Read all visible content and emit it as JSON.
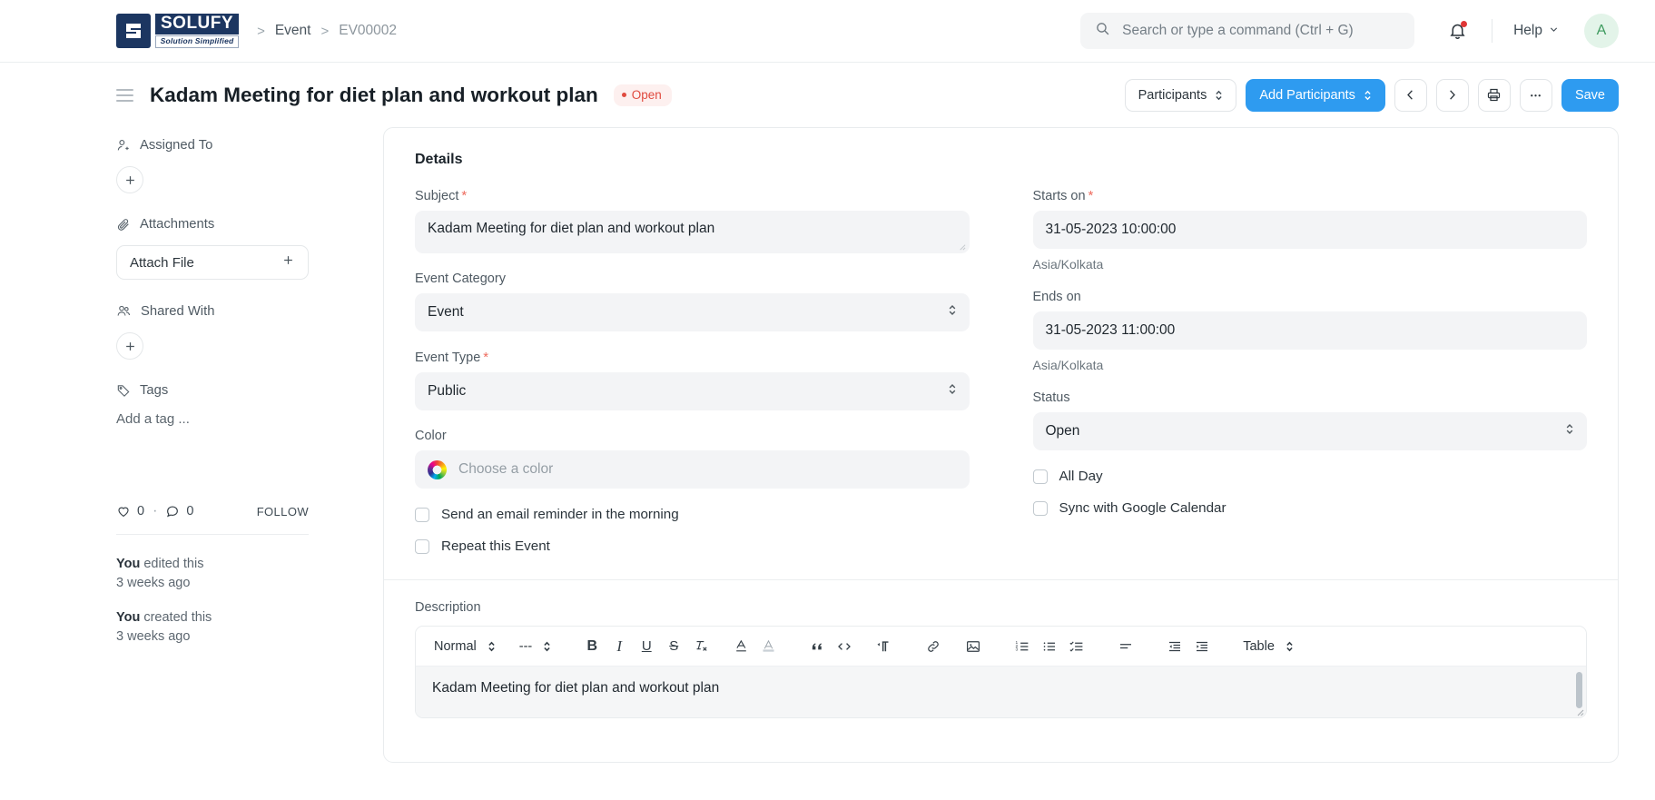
{
  "navbar": {
    "logo": {
      "name": "SOLUFY",
      "tagline": "Solution Simplified"
    },
    "breadcrumbs": [
      {
        "label": "Event",
        "muted": false
      },
      {
        "label": "EV00002",
        "muted": true
      }
    ],
    "separator": ">",
    "search": {
      "placeholder": "Search or type a command (Ctrl + G)",
      "value": "",
      "icon": "search-icon"
    },
    "notifications": {
      "icon": "bell-icon",
      "has_unread": true,
      "dot_color": "#e03636"
    },
    "help": {
      "label": "Help",
      "icon": "chevron-down-icon"
    },
    "avatar": {
      "initial": "A",
      "bg": "#e3f4e9",
      "fg": "#3f9b5f"
    }
  },
  "pagehead": {
    "menu_icon": "hamburger-icon",
    "title": "Kadam Meeting for diet plan and workout plan",
    "status": {
      "label": "Open",
      "color": "#e04a3f",
      "bg": "#fdf0ef"
    },
    "actions": {
      "participants": "Participants",
      "add_participants": "Add Participants",
      "prev_icon": "chevron-left-icon",
      "next_icon": "chevron-right-icon",
      "print_icon": "printer-icon",
      "more_icon": "ellipsis-icon",
      "save": "Save"
    },
    "accent": "#2e9bf0"
  },
  "sidebar": {
    "sections": [
      {
        "label": "Assigned To",
        "icon": "user-plus-icon",
        "control": "add-button"
      },
      {
        "label": "Attachments",
        "icon": "paperclip-icon",
        "control": "attach-file",
        "button_label": "Attach File",
        "button_icon": "plus-icon"
      },
      {
        "label": "Shared With",
        "icon": "users-icon",
        "control": "add-button"
      },
      {
        "label": "Tags",
        "icon": "tag-icon",
        "control": "tag-input",
        "placeholder": "Add a tag ..."
      }
    ],
    "social": {
      "like_icon": "heart-icon",
      "like_count": "0",
      "separator": "·",
      "comment_icon": "comment-icon",
      "comment_count": "0",
      "follow_label": "FOLLOW"
    },
    "activity": [
      {
        "actor": "You",
        "action": "edited this",
        "time": "3 weeks ago"
      },
      {
        "actor": "You",
        "action": "created this",
        "time": "3 weeks ago"
      }
    ]
  },
  "details": {
    "heading": "Details",
    "left": {
      "subject": {
        "label": "Subject",
        "required": true,
        "value": "Kadam Meeting for diet plan and workout plan"
      },
      "event_category": {
        "label": "Event Category",
        "required": false,
        "value": "Event"
      },
      "event_type": {
        "label": "Event Type",
        "required": true,
        "value": "Public"
      },
      "color": {
        "label": "Color",
        "required": false,
        "value": "",
        "placeholder": "Choose a color",
        "icon": "color-wheel-icon"
      },
      "email_reminder": {
        "label": "Send an email reminder in the morning",
        "checked": false
      },
      "repeat_event": {
        "label": "Repeat this Event",
        "checked": false
      }
    },
    "right": {
      "starts_on": {
        "label": "Starts on",
        "required": true,
        "value": "31-05-2023 10:00:00",
        "timezone": "Asia/Kolkata"
      },
      "ends_on": {
        "label": "Ends on",
        "required": false,
        "value": "31-05-2023 11:00:00",
        "timezone": "Asia/Kolkata"
      },
      "status": {
        "label": "Status",
        "required": false,
        "value": "Open"
      },
      "all_day": {
        "label": "All Day",
        "checked": false
      },
      "sync_google": {
        "label": "Sync with Google Calendar",
        "checked": false
      }
    }
  },
  "description": {
    "label": "Description",
    "toolbar": {
      "style_select": "Normal",
      "font_select": "---",
      "bold": "B",
      "italic": "I",
      "underline": "U",
      "strike": "S",
      "clear_format_icon": "clear-formatting-icon",
      "font_color_icon": "font-color-icon",
      "highlight_icon": "highlight-icon",
      "quote_icon": "blockquote-icon",
      "code_icon": "code-icon",
      "direction_icon": "text-direction-icon",
      "link_icon": "link-icon",
      "image_icon": "image-icon",
      "ordered_list_icon": "ordered-list-icon",
      "bullet_list_icon": "bullet-list-icon",
      "check_list_icon": "check-list-icon",
      "align_icon": "align-icon",
      "outdent_icon": "outdent-icon",
      "indent_icon": "indent-icon",
      "table_select": "Table"
    },
    "content": "Kadam Meeting for diet plan and workout plan"
  }
}
